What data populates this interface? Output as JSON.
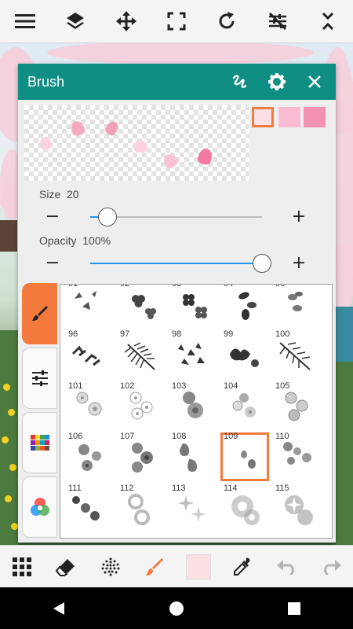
{
  "topbar": {
    "icons": [
      "menu-icon",
      "layers-icon",
      "move-icon",
      "fit-screen-icon",
      "rotate-icon",
      "adjust-off-icon",
      "collapse-icon"
    ]
  },
  "panel": {
    "title": "Brush",
    "header_icons": [
      "brush-stroke-icon",
      "settings-icon",
      "close-icon"
    ],
    "swatch_colors": [
      "#fde0e6",
      "#f9bcd3",
      "#f391b4"
    ],
    "size": {
      "label": "Size",
      "value": "20",
      "fraction": 0.1
    },
    "opacity": {
      "label": "Opacity",
      "value": "100%",
      "fraction": 1.0
    },
    "tabs": [
      "brush-tab-icon",
      "adjust-tab-icon",
      "palette-tab-icon",
      "color-wheel-tab-icon"
    ],
    "brushes": [
      "91",
      "92",
      "93",
      "94",
      "95",
      "96",
      "97",
      "98",
      "99",
      "100",
      "101",
      "102",
      "103",
      "104",
      "105",
      "106",
      "107",
      "108",
      "109",
      "110",
      "111",
      "112",
      "113",
      "114",
      "115"
    ],
    "selected_brush": "109"
  },
  "bottombar": {
    "icons": [
      "grid-icon",
      "eraser-icon",
      "dots-icon",
      "brush-icon",
      "current-color",
      "eyedropper-icon",
      "undo-icon",
      "redo-icon"
    ],
    "current_color": "#fde0e6",
    "accent": "#f47a3e"
  },
  "navbar": {
    "icons": [
      "back-icon",
      "home-icon",
      "recents-icon"
    ]
  }
}
